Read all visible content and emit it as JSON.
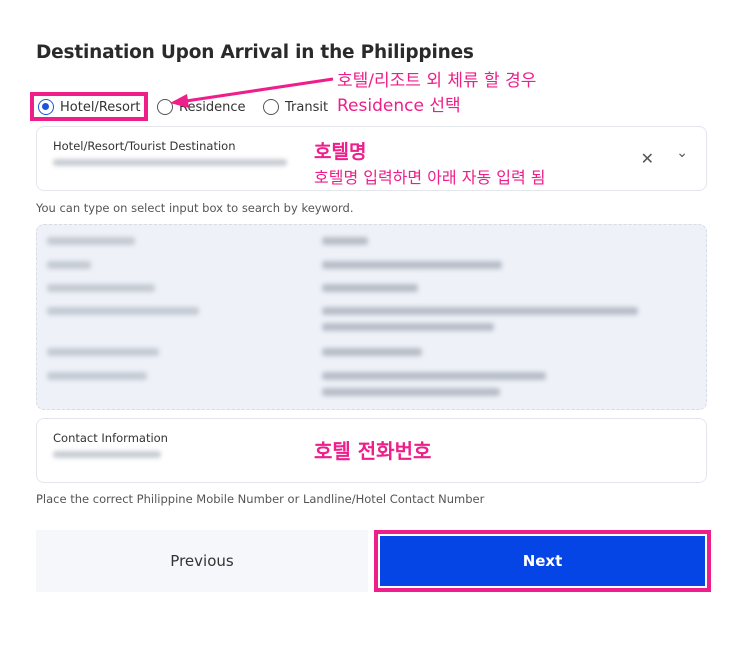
{
  "section": {
    "title": "Destination Upon Arrival in the Philippines"
  },
  "radio_options": {
    "hotel": {
      "label": "Hotel/Resort",
      "checked": true
    },
    "residence": {
      "label": "Residence",
      "checked": false
    },
    "transit": {
      "label": "Transit",
      "checked": false
    }
  },
  "hotel_field": {
    "label": "Hotel/Resort/Tourist Destination",
    "hint": "You can type on select input box to search by keyword."
  },
  "contact_field": {
    "label": "Contact Information",
    "hint": "Place the correct Philippine Mobile Number or Landline/Hotel Contact Number"
  },
  "buttons": {
    "previous": "Previous",
    "next": "Next"
  },
  "annotations": {
    "residence_line1": "호텔/리조트 외 체류 할 경우",
    "residence_line2": "Residence 선택",
    "hotel_name_title": "호텔명",
    "hotel_name_desc": "호텔명 입력하면 아래 자동 입력 됨",
    "hotel_phone": "호텔 전화번호"
  },
  "colors": {
    "accent": "#0645e5",
    "annotation": "#ee1e8a",
    "radio_checked": "#1a56db"
  }
}
